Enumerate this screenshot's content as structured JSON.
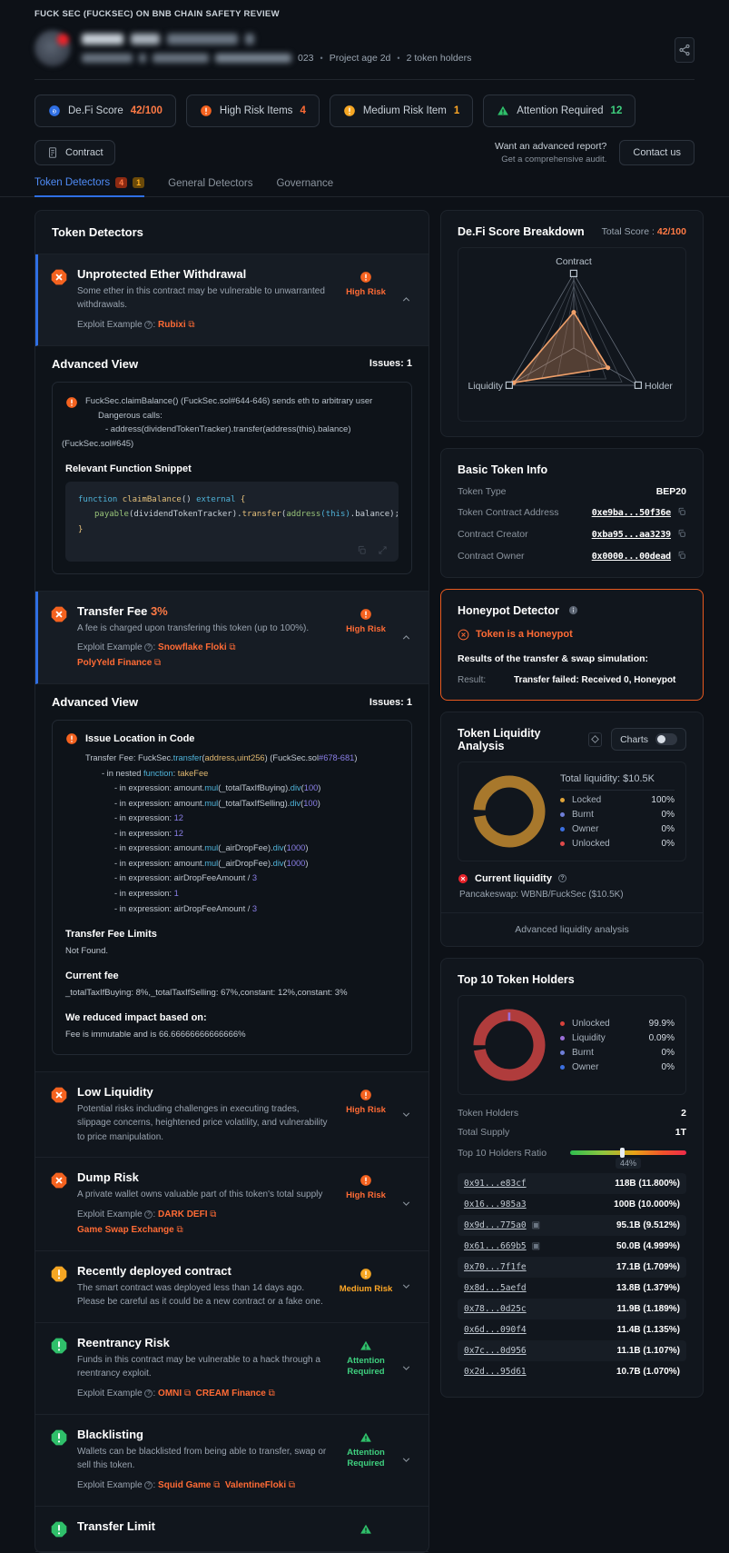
{
  "header": {
    "eyebrow": "FUCK SEC (FUCKSEC) ON BNB CHAIN SAFETY REVIEW",
    "meta_year": "023",
    "project_age": "Project age 2d",
    "token_holders": "2 token holders",
    "share_icon": "share-icon"
  },
  "pills": [
    {
      "icon": "defi-score-icon",
      "label": "De.Fi Score",
      "value": "42/100",
      "value_color": "#ff7a45"
    },
    {
      "icon": "high-risk-icon",
      "label": "High Risk Items",
      "value": "4",
      "value_color": "#ff6b35"
    },
    {
      "icon": "medium-risk-icon",
      "label": "Medium Risk Item",
      "value": "1",
      "value_color": "#ffa726"
    },
    {
      "icon": "attention-icon",
      "label": "Attention Required",
      "value": "12",
      "value_color": "#3fd07f"
    }
  ],
  "contract_button": "Contract",
  "advanced_report": {
    "line1": "Want an advanced report?",
    "line2": "Get a comprehensive audit.",
    "cta": "Contact us"
  },
  "tabs": [
    {
      "label": "Token Detectors",
      "badges": [
        "4",
        "1"
      ],
      "active": true
    },
    {
      "label": "General Detectors",
      "badges": [],
      "active": false
    },
    {
      "label": "Governance",
      "badges": [],
      "active": false
    }
  ],
  "detectors": {
    "title": "Token Detectors",
    "items": [
      {
        "name": "Unprotected Ether Withdrawal",
        "severity_icon": "x-octagon-icon",
        "severity": "high",
        "desc": "Some ether in this contract may be vulnerable to unwarranted withdrawals.",
        "exploit_label": "Exploit Example",
        "exploits": [
          "Rubixi"
        ],
        "level": "High Risk",
        "expanded": true
      },
      {
        "name": "Transfer Fee",
        "pct": "3%",
        "severity_icon": "x-octagon-icon",
        "severity": "high",
        "desc": "A fee is charged upon transfering this token (up to 100%).",
        "exploit_label": "Exploit Example",
        "exploits": [
          "Snowflake Floki",
          "PolyYeld Finance"
        ],
        "level": "High Risk",
        "expanded": true
      },
      {
        "name": "Low Liquidity",
        "severity_icon": "x-octagon-icon",
        "severity": "high",
        "desc": "Potential risks including challenges in executing trades, slippage concerns, heightened price volatility, and vulnerability to price manipulation.",
        "exploits": [],
        "level": "High Risk",
        "expanded": false
      },
      {
        "name": "Dump Risk",
        "severity_icon": "x-octagon-icon",
        "severity": "high",
        "desc": "A private wallet owns valuable part of this token's total supply",
        "exploit_label": "Exploit Example",
        "exploits": [
          "DARK DEFI",
          "Game Swap Exchange"
        ],
        "level": "High Risk",
        "expanded": false
      },
      {
        "name": "Recently deployed contract",
        "severity_icon": "exclamation-octagon-icon",
        "severity": "medium",
        "desc": "The smart contract was deployed less than 14 days ago. Please be careful as it could be a new contract or a fake one.",
        "exploits": [],
        "level": "Medium Risk",
        "expanded": false
      },
      {
        "name": "Reentrancy Risk",
        "severity_icon": "exclamation-octagon-green-icon",
        "severity": "attention",
        "desc": "Funds in this contract may be vulnerable to a hack through a reentrancy exploit.",
        "exploit_label": "Exploit Example",
        "exploits": [
          "OMNI",
          "CREAM Finance"
        ],
        "level": "Attention Required",
        "expanded": false
      },
      {
        "name": "Blacklisting",
        "severity_icon": "exclamation-octagon-green-icon",
        "severity": "attention",
        "desc": "Wallets can be blacklisted from being able to transfer, swap or sell this token.",
        "exploit_label": "Exploit Example",
        "exploits": [
          "Squid Game",
          "ValentineFloki"
        ],
        "level": "Attention Required",
        "expanded": false
      },
      {
        "name": "Transfer Limit",
        "severity_icon": "exclamation-octagon-green-icon",
        "severity": "attention",
        "desc": "",
        "exploits": [],
        "level": "Attention Required",
        "expanded": false
      }
    ]
  },
  "advanced_view_1": {
    "title": "Advanced View",
    "issues": "Issues: 1",
    "issue_lines": [
      "FuckSec.claimBalance() (FuckSec.sol#644-646) sends eth to arbitrary user",
      "Dangerous calls:",
      "- address(dividendTokenTracker).transfer(address(this).balance)",
      "(FuckSec.sol#645)"
    ],
    "snippet_label": "Relevant Function Snippet",
    "code": "function claimBalance() external {\n    payable(dividendTokenTracker).transfer(address(this).balance);\n}",
    "copy_icon": "copy-icon",
    "expand_icon": "expand-icon"
  },
  "advanced_view_2": {
    "title": "Advanced View",
    "issues": "Issues: 1",
    "issue_title": "Issue Location in Code",
    "loc_line": "Transfer Fee: FuckSec.transfer(address,uint256) (FuckSec.sol#678-681)",
    "nested": "- in nested function: takeFee",
    "expressions": [
      "- in expression: amount.mul(_totalTaxIfBuying).div(100)",
      "- in expression: amount.mul(_totalTaxIfSelling).div(100)",
      "- in expression: 12",
      "- in expression: 12",
      "- in expression: amount.mul(_airDropFee).div(1000)",
      "- in expression: amount.mul(_airDropFee).div(1000)",
      "- in expression: airDropFeeAmount / 3",
      "- in expression: 1",
      "- in expression: airDropFeeAmount / 3"
    ],
    "limits_label": "Transfer Fee Limits",
    "limits_value": "Not Found.",
    "current_fee_label": "Current fee",
    "current_fee_value": "_totalTaxIfBuying: 8%,_totalTaxIfSelling: 67%,constant: 12%,constant: 3%",
    "reduced_label": "We reduced impact based on:",
    "reduced_value": "Fee is immutable and is 66.66666666666666%"
  },
  "score_breakdown": {
    "title": "De.Fi Score Breakdown",
    "total_label": "Total Score :",
    "total_value": "42/100"
  },
  "chart_data": [
    {
      "type": "radar",
      "title": "De.Fi Score Breakdown",
      "axes": [
        "Contract",
        "Holder",
        "Liquidity"
      ],
      "values": [
        0.48,
        0.53,
        0.93
      ],
      "max": 1,
      "rings": 4,
      "series_color": "#f0a06a",
      "fill_color": "rgba(240,160,106,0.32)"
    },
    {
      "type": "pie",
      "title": "Total liquidity: $10.5K",
      "labels": [
        "Locked",
        "Burnt",
        "Owner",
        "Unlocked"
      ],
      "values": [
        100,
        0,
        0,
        0
      ],
      "value_labels": [
        "100%",
        "0%",
        "0%",
        "0%"
      ],
      "colors": [
        "#e0a43a",
        "#6f7fd8",
        "#3b6fe0",
        "#e04a4a"
      ],
      "donut": true,
      "legend": "right"
    },
    {
      "type": "pie",
      "title": "Top 10 Token Holders",
      "labels": [
        "Unlocked",
        "Liquidity",
        "Burnt",
        "Owner"
      ],
      "values": [
        99.9,
        0.09,
        0,
        0
      ],
      "value_labels": [
        "99.9%",
        "0.09%",
        "0%",
        "0%"
      ],
      "colors": [
        "#b03c3c",
        "#9b6fd8",
        "#6f7fd8",
        "#3b6fe0"
      ],
      "donut": true,
      "legend": "right"
    }
  ],
  "basic_token_info": {
    "title": "Basic Token Info",
    "rows": [
      {
        "key": "Token Type",
        "value": "BEP20",
        "copy": false
      },
      {
        "key": "Token Contract Address",
        "value": "0xe9ba...50f36e",
        "copy": true
      },
      {
        "key": "Contract Creator",
        "value": "0xba95...aa3239",
        "copy": true
      },
      {
        "key": "Contract Owner",
        "value": "0x0000...00dead",
        "copy": true
      }
    ]
  },
  "honeypot": {
    "title": "Honeypot Detector",
    "info_icon": "info-icon",
    "flag_icon": "x-circle-icon",
    "flag": "Token is a Honeypot",
    "sub": "Results of the transfer & swap simulation:",
    "result_key": "Result:",
    "result_value": "Transfer failed: Received 0, Honeypot",
    "border_color": "#e8591f"
  },
  "liquidity": {
    "title": "Token Liquidity Analysis",
    "diamond_icon": "diamond-icon",
    "toggle_label": "Charts",
    "total_label": "Total liquidity:",
    "total_value": "$10.5K",
    "legend": [
      {
        "label": "Locked",
        "value": "100%",
        "color": "#e0a43a"
      },
      {
        "label": "Burnt",
        "value": "0%",
        "color": "#6f7fd8"
      },
      {
        "label": "Owner",
        "value": "0%",
        "color": "#3b6fe0"
      },
      {
        "label": "Unlocked",
        "value": "0%",
        "color": "#e04a4a"
      }
    ],
    "current_label": "Current liquidity",
    "current_icon": "x-circle-red-icon",
    "current_value": "Pancakeswap: WBNB/FuckSec ($10.5K)",
    "advanced_link": "Advanced liquidity analysis"
  },
  "top_holders": {
    "title": "Top 10 Token Holders",
    "legend": [
      {
        "label": "Unlocked",
        "value": "99.9%",
        "color": "#b03c3c"
      },
      {
        "label": "Liquidity",
        "value": "0.09%",
        "color": "#9b6fd8"
      },
      {
        "label": "Burnt",
        "value": "0%",
        "color": "#6f7fd8"
      },
      {
        "label": "Owner",
        "value": "0%",
        "color": "#3b6fe0"
      }
    ],
    "stats": [
      {
        "key": "Token Holders",
        "value": "2"
      },
      {
        "key": "Total Supply",
        "value": "1T"
      }
    ],
    "ratio_label": "Top 10 Holders Ratio",
    "ratio_value": "44%",
    "holders": [
      {
        "address": "0x91...e83cf",
        "amount": "118B (11.800%)",
        "tag": false
      },
      {
        "address": "0x16...985a3",
        "amount": "100B (10.000%)",
        "tag": false
      },
      {
        "address": "0x9d...775a0",
        "amount": "95.1B (9.512%)",
        "tag": true
      },
      {
        "address": "0x61...669b5",
        "amount": "50.0B (4.999%)",
        "tag": true
      },
      {
        "address": "0x70...7f1fe",
        "amount": "17.1B (1.709%)",
        "tag": false
      },
      {
        "address": "0x8d...5aefd",
        "amount": "13.8B (1.379%)",
        "tag": false
      },
      {
        "address": "0x78...0d25c",
        "amount": "11.9B (1.189%)",
        "tag": false
      },
      {
        "address": "0x6d...090f4",
        "amount": "11.4B (1.135%)",
        "tag": false
      },
      {
        "address": "0x7c...0d956",
        "amount": "11.1B (1.107%)",
        "tag": false
      },
      {
        "address": "0x2d...95d61",
        "amount": "10.7B (1.070%)",
        "tag": false
      }
    ]
  }
}
